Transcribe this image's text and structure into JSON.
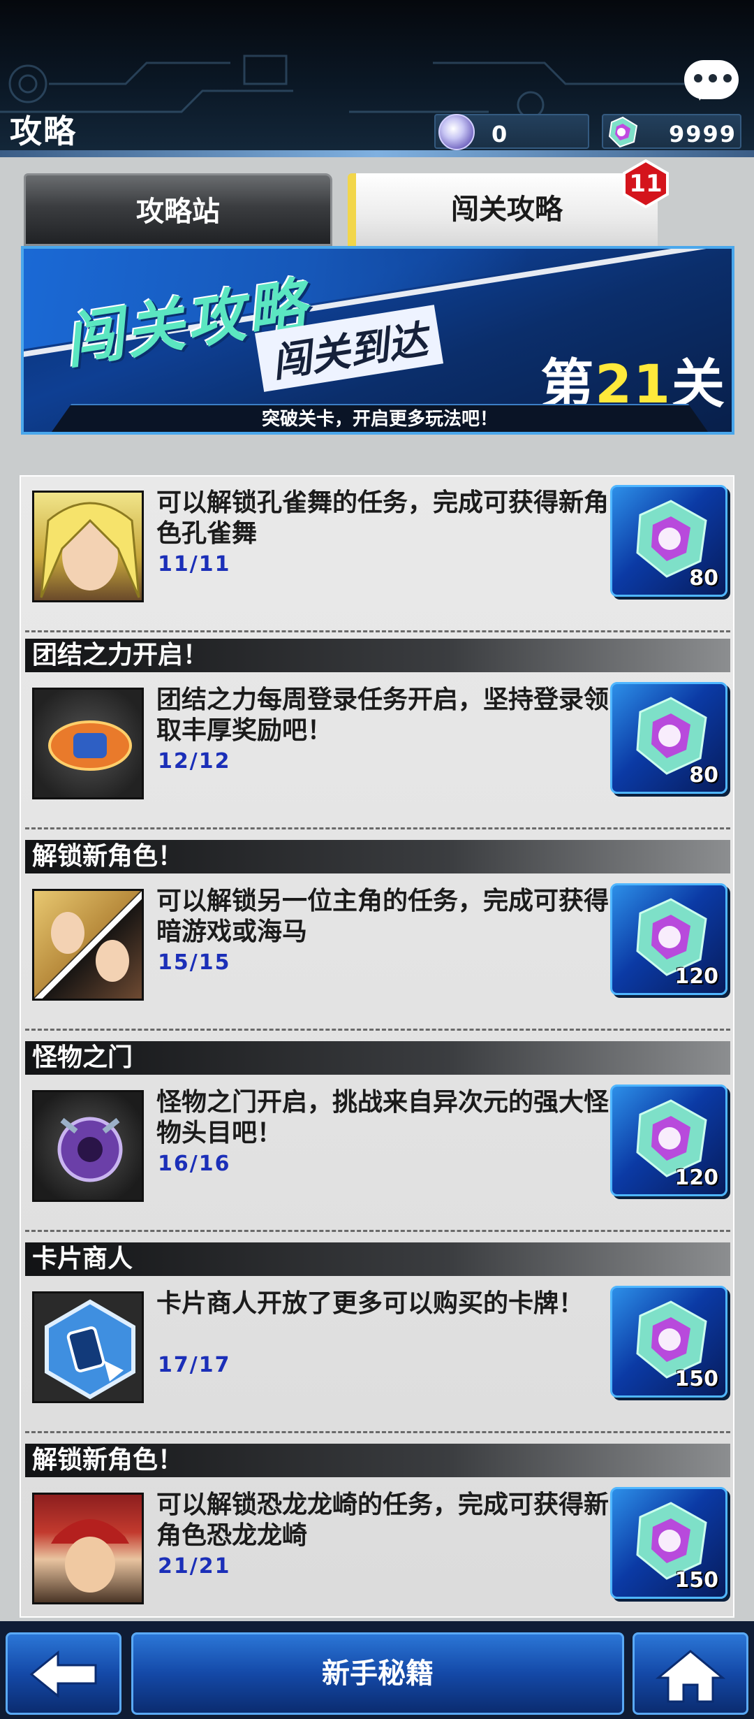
{
  "header": {
    "title": "攻略",
    "currency_orb": "0",
    "currency_gem": "9999"
  },
  "tabs": [
    {
      "label": "攻略站",
      "active": false
    },
    {
      "label": "闯关攻略",
      "active": true,
      "badge": "11"
    }
  ],
  "banner": {
    "title": "闯关攻略",
    "subtitle": "闯关到达",
    "stage_prefix": "第",
    "stage_number": "21",
    "stage_suffix": "关",
    "footer": "突破关卡，开启更多玩法吧！"
  },
  "items": [
    {
      "header": "",
      "desc": "可以解锁孔雀舞的任务，完成可获得新角色孔雀舞",
      "progress": "11/11",
      "reward": "80",
      "thumb_icon": "character-portrait-icon"
    },
    {
      "header": "团结之力开启！",
      "desc": "团结之力每周登录任务开启，坚持登录领取丰厚奖励吧！",
      "progress": "12/12",
      "reward": "80",
      "thumb_icon": "unity-hands-icon"
    },
    {
      "header": "解锁新角色！",
      "desc": "可以解锁另一位主角的任务，完成可获得暗游戏或海马",
      "progress": "15/15",
      "reward": "120",
      "thumb_icon": "character-portrait-icon"
    },
    {
      "header": "怪物之门",
      "desc": "怪物之门开启，挑战来自异次元的强大怪物头目吧！",
      "progress": "16/16",
      "reward": "120",
      "thumb_icon": "monster-gate-icon"
    },
    {
      "header": "卡片商人",
      "desc": "卡片商人开放了更多可以购买的卡牌！",
      "progress": "17/17",
      "reward": "150",
      "thumb_icon": "card-shop-icon"
    },
    {
      "header": "解锁新角色！",
      "desc": "可以解锁恐龙龙崎的任务，完成可获得新角色恐龙龙崎",
      "progress": "21/21",
      "reward": "150",
      "thumb_icon": "character-portrait-icon"
    }
  ],
  "footer": {
    "main_label": "新手秘籍",
    "back_icon": "back-arrow-icon",
    "home_icon": "home-icon"
  },
  "colors": {
    "accent_blue": "#1449a8",
    "progress_text": "#1b2fb8",
    "badge_red": "#d4141c",
    "stage_number": "#ffe93b"
  }
}
